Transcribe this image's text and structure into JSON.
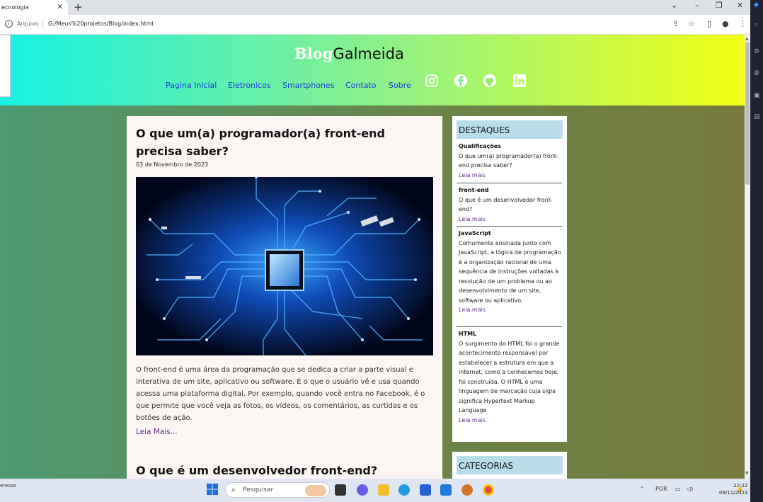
{
  "browser": {
    "tab_title": "ecnologia",
    "address_prefix": "Arquivo",
    "url": "G:/Meus%20projetos/Blog/index.html"
  },
  "header": {
    "logo_part1": "Blog",
    "logo_part2": "Galmeida",
    "nav": [
      "Pagina Inicial",
      "Eletronicos",
      "Smartphones",
      "Contato",
      "Sobre"
    ],
    "social_icons": [
      "instagram-icon",
      "facebook-icon",
      "github-icon",
      "linkedin-icon"
    ]
  },
  "main": {
    "post_title": "O que um(a) programador(a) front-end precisa saber?",
    "post_date": "03 de Novembro de 2023",
    "post_body": "O front-end é uma área da programação que se dedica a criar a parte visual e interativa de um site, aplicativo ou software. É o que o usuário vê e usa quando acessa uma plataforma digital. Por exemplo, quando você entra no Facebook, é o que permite que você veja as fotos, os vídeos, os comentários, as curtidas e os botões de ação.",
    "read_more": "Leia Mais...",
    "post2_title": "O que é um desenvolvedor front-end?"
  },
  "sidebar": {
    "heading": "DESTAQUES",
    "items": [
      {
        "title": "Qualificações",
        "text": "O que um(a) programador(a) front-end precisa saber?",
        "link": "Leia mais"
      },
      {
        "title": "front-end",
        "text": "O que é um desenvolvedor front-end?",
        "link": "Leia mais"
      },
      {
        "title": "JavaScript",
        "text": "Comumente ensinada junto com JavaScript, a lógica de programação é a organização racional de uma sequência de instruções voltadas à resolução de um problema ou ao desenvolvimento de um site, software ou aplicativo.",
        "link": "Leia mais"
      },
      {
        "title": "HTML",
        "text": "O surgimento do HTML foi o grande acontecimento responsável por estabelecer a estrutura em que a internet, como a conhecemos hoje, foi construída. O HTML é uma linguagem de marcação cuja sigla significa Hypertext Markup Language",
        "link": "Leia mais"
      }
    ],
    "categories_heading": "CATEGORIAS"
  },
  "taskbar": {
    "left_text": "eresse",
    "search_placeholder": "Pesquisar",
    "language": "POR",
    "time": "22:22",
    "date": "09/11/2023"
  }
}
